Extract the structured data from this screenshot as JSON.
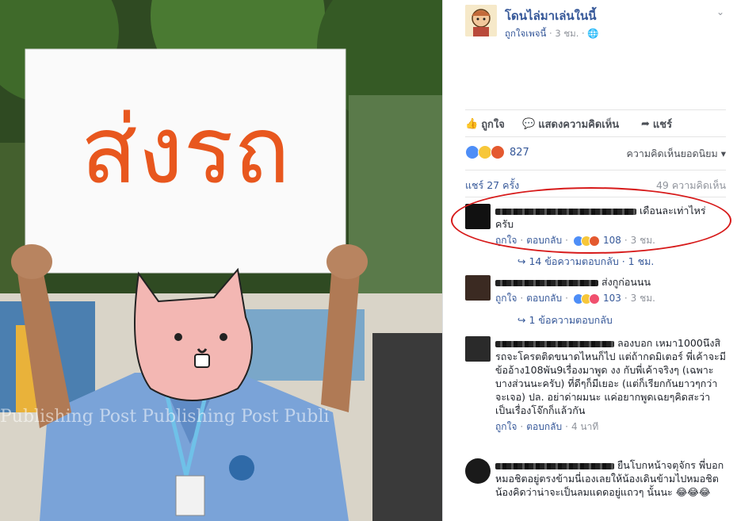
{
  "photo": {
    "sign_text": "ส่งรถ",
    "watermark": "Publishing   Post Publishing   Post Publi"
  },
  "post": {
    "page_name": "โดนไล่มาเล่นในนี้",
    "author": "ถูกใจเพจนี้",
    "time": "3 ชม."
  },
  "actions": {
    "like": "ถูกใจ",
    "comment": "แสดงความคิดเห็น",
    "share": "แชร์"
  },
  "reactions": {
    "count": "827",
    "sort_label": "ความคิดเห็นยอดนิยม"
  },
  "stats": {
    "shares": "แชร์ 27 ครั้ง",
    "comments": "49 ความคิดเห็น"
  },
  "comments": [
    {
      "text": "เดือนละเท่าไหร่ ครับ",
      "like": "ถูกใจ",
      "reply": "ตอบกลับ",
      "reaction_count": "108",
      "time": "3 ชม.",
      "replies": "14 ข้อความตอบกลับ · 1 ชม."
    },
    {
      "text": "ส่งกูก่อนนน",
      "like": "ถูกใจ",
      "reply": "ตอบกลับ",
      "reaction_count": "103",
      "time": "3 ชม.",
      "replies": "1 ข้อความตอบกลับ"
    },
    {
      "text": "ลองบอก เหมา1000นึงสิ รถจะโครตติดขนาดไหนก็ไป แต่ถ้ากดมิเตอร์ พี่เค้าจะมีข้ออ้าง108พัน9เรื่องมาพูด งง กับพี่เค้าจริงๆ (เฉพาะบางส่วนนะครับ) ที่ดีๆก็มีเยอะ (แต่ก็เรียกกันยาวๆกว่าจะเจอ) ปล. อย่าด่าผมนะ แค่อยากพูดเฉยๆคิดสะว่าเป็นเรื่องโจ๊กก็แล้วกัน",
      "like": "ถูกใจ",
      "reply": "ตอบกลับ",
      "time": "4 นาที"
    },
    {
      "text": "ยืนโบกหน้าจตุจักร พี่บอกหมอชิตอยู่ตรงข้ามนี่เองเลยให้น้องเดินข้ามไปหมอชิต น้องคิดว่าน่าจะเป็นลมแดดอยู่แถวๆ นั้นนะ 😂😂😂"
    }
  ]
}
